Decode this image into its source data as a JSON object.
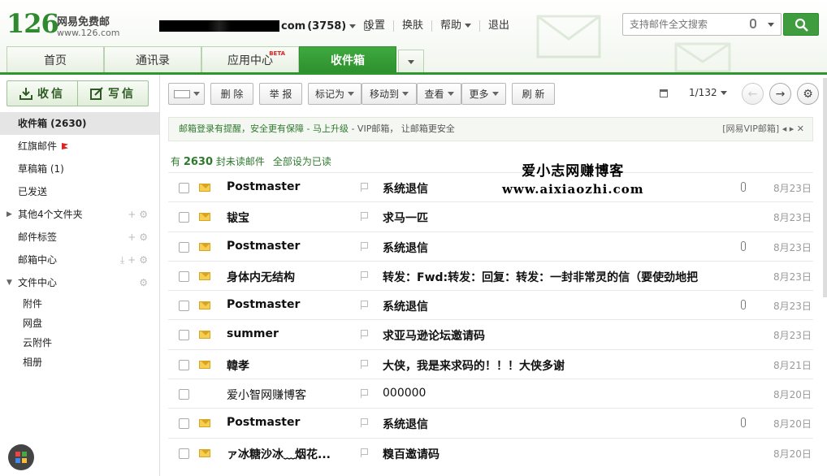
{
  "brand": {
    "logo_num": "126",
    "logo_title": "网易免费邮",
    "logo_url": "www.126.com"
  },
  "account": {
    "address_suffix": "com",
    "unread_count": "(3758)"
  },
  "top_links": [
    "设置",
    "换肤",
    "帮助",
    "退出"
  ],
  "search": {
    "placeholder": "支持邮件全文搜索"
  },
  "tabs": [
    {
      "label": "首页"
    },
    {
      "label": "通讯录"
    },
    {
      "label": "应用中心",
      "badge": "BETA"
    },
    {
      "label": "收件箱"
    }
  ],
  "compose": {
    "receive": "收信",
    "write": "写信"
  },
  "folders": {
    "inbox": "收件箱 (2630)",
    "flagged": "红旗邮件",
    "drafts": "草稿箱 (1)",
    "sent": "已发送",
    "other": "其他4个文件夹",
    "tags": "邮件标签",
    "center": "邮箱中心",
    "files": "文件中心",
    "files_sub": [
      "附件",
      "网盘",
      "云附件",
      "相册"
    ]
  },
  "toolbar": {
    "delete": "删 除",
    "report": "举 报",
    "mark_as": "标记为",
    "move_to": "移动到",
    "view": "查看",
    "more": "更多",
    "refresh": "刷 新",
    "pager": "1/132"
  },
  "notice": {
    "text1": "邮箱登录有提醒，安全更有保障",
    "text2": " - 马上升级",
    "text3": " - VIP邮箱， 让邮箱更安全",
    "right": "[网易VIP邮箱]"
  },
  "unread": {
    "prefix": "有 ",
    "count": "2630",
    "suffix": " 封未读邮件",
    "mark_all": "全部设为已读"
  },
  "watermark": {
    "line1": "爱小志网赚博客",
    "line2": "www.aixiaozhi.com"
  },
  "mails": [
    {
      "sender": "Postmaster",
      "subject": "系统退信",
      "date": "8月23日",
      "unread": true,
      "attach": true
    },
    {
      "sender": "韨宝",
      "subject": "求马一匹",
      "date": "8月23日",
      "unread": true,
      "attach": false
    },
    {
      "sender": "Postmaster",
      "subject": "系统退信",
      "date": "8月23日",
      "unread": true,
      "attach": true
    },
    {
      "sender": "身体内无结构",
      "subject": "转发：Fwd:转发：回复：转发：一封非常灵的信（要使劲地把",
      "date": "8月23日",
      "unread": true,
      "attach": false
    },
    {
      "sender": "Postmaster",
      "subject": "系统退信",
      "date": "8月23日",
      "unread": true,
      "attach": true
    },
    {
      "sender": "summer",
      "subject": "求亚马逊论坛邀请码",
      "date": "8月23日",
      "unread": true,
      "attach": false
    },
    {
      "sender": "韓孝",
      "subject": "大侠，我是来求码的！！！大侠多谢",
      "date": "8月21日",
      "unread": true,
      "attach": false
    },
    {
      "sender": "爱小智网赚博客",
      "subject": "000000",
      "date": "8月20日",
      "unread": false,
      "attach": false
    },
    {
      "sender": "Postmaster",
      "subject": "系统退信",
      "date": "8月20日",
      "unread": true,
      "attach": true
    },
    {
      "sender": "ァ冰糖沙冰﹏烟花...",
      "subject": "糗百邀请码",
      "date": "8月20日",
      "unread": true,
      "attach": false
    }
  ],
  "colors": {
    "brand_green": "#2f952f",
    "unread_green": "#2d7a2d",
    "envelope": "#f6cf52"
  }
}
